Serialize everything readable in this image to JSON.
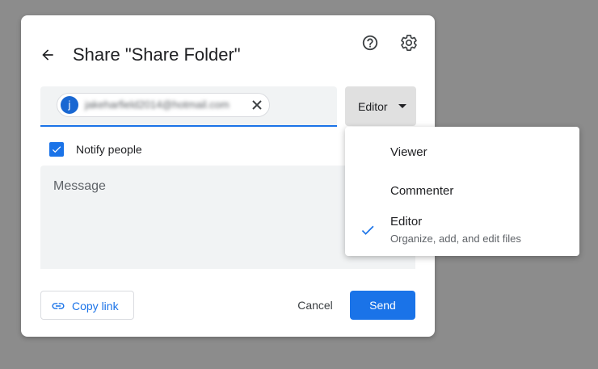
{
  "dialog": {
    "title": "Share \"Share Folder\"",
    "back_icon": "arrow-back-icon",
    "help_icon": "help-circle-icon",
    "settings_icon": "gear-icon"
  },
  "recipients": {
    "chips": [
      {
        "avatar_letter": "j",
        "email": "jakeharfield2014@hotmail.com",
        "avatar_color": "#1967d2"
      }
    ],
    "remove_icon": "close-icon"
  },
  "role_select": {
    "selected": "Editor",
    "caret_icon": "caret-down-icon"
  },
  "notify": {
    "label": "Notify people",
    "checked": true
  },
  "message": {
    "placeholder": "Message",
    "value": ""
  },
  "footer": {
    "copy_link_label": "Copy link",
    "copy_link_icon": "link-icon",
    "cancel_label": "Cancel",
    "send_label": "Send"
  },
  "role_menu": {
    "items": [
      {
        "label": "Viewer",
        "description": "",
        "selected": false
      },
      {
        "label": "Commenter",
        "description": "",
        "selected": false
      },
      {
        "label": "Editor",
        "description": "Organize, add, and edit files",
        "selected": true
      }
    ],
    "check_icon": "check-icon"
  },
  "colors": {
    "accent": "#1a73e8",
    "backdrop": "#8c8c8c",
    "field_background": "#f1f3f4"
  }
}
